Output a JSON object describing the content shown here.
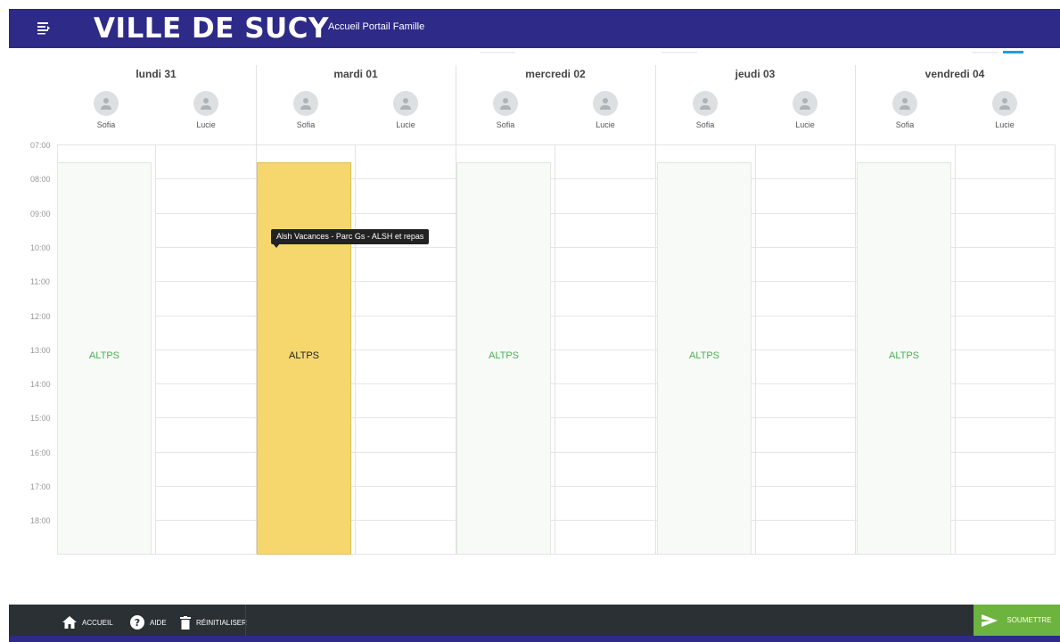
{
  "header": {
    "brand": "VILLE DE SUCY",
    "subtitle": "Accueil Portail Famille",
    "menu_icon": "menu-icon"
  },
  "calendar": {
    "days": [
      {
        "label": "lundi 31"
      },
      {
        "label": "mardi 01"
      },
      {
        "label": "mercredi 02"
      },
      {
        "label": "jeudi 03"
      },
      {
        "label": "vendredi 04"
      }
    ],
    "children": [
      "Sofia",
      "Lucie"
    ],
    "times": [
      "07:00",
      "08:00",
      "09:00",
      "10:00",
      "11:00",
      "12:00",
      "13:00",
      "14:00",
      "15:00",
      "16:00",
      "17:00",
      "18:00"
    ],
    "events": [
      {
        "day": "lundi 31",
        "child": "Sofia",
        "label": "ALTPS",
        "selected": false
      },
      {
        "day": "mardi 01",
        "child": "Sofia",
        "label": "ALTPS",
        "selected": true
      },
      {
        "day": "mercredi 02",
        "child": "Sofia",
        "label": "ALTPS",
        "selected": false
      },
      {
        "day": "jeudi 03",
        "child": "Sofia",
        "label": "ALTPS",
        "selected": false
      },
      {
        "day": "vendredi 04",
        "child": "Sofia",
        "label": "ALTPS",
        "selected": false
      }
    ],
    "tooltip": "Alsh Vacances - Parc Gs - ALSH et repas"
  },
  "footer": {
    "home_label": "ACCUEIL",
    "help_label": "AIDE",
    "reset_label": "RÉINITIALISER",
    "submit_label": "SOUMETTRE"
  },
  "colors": {
    "header_bg": "#2e2a87",
    "footer_bg": "#2b3035",
    "submit_bg": "#6cb33f",
    "selected_event": "#f5d76e",
    "event_text": "#4caf50",
    "accent": "#1ea0e0"
  }
}
